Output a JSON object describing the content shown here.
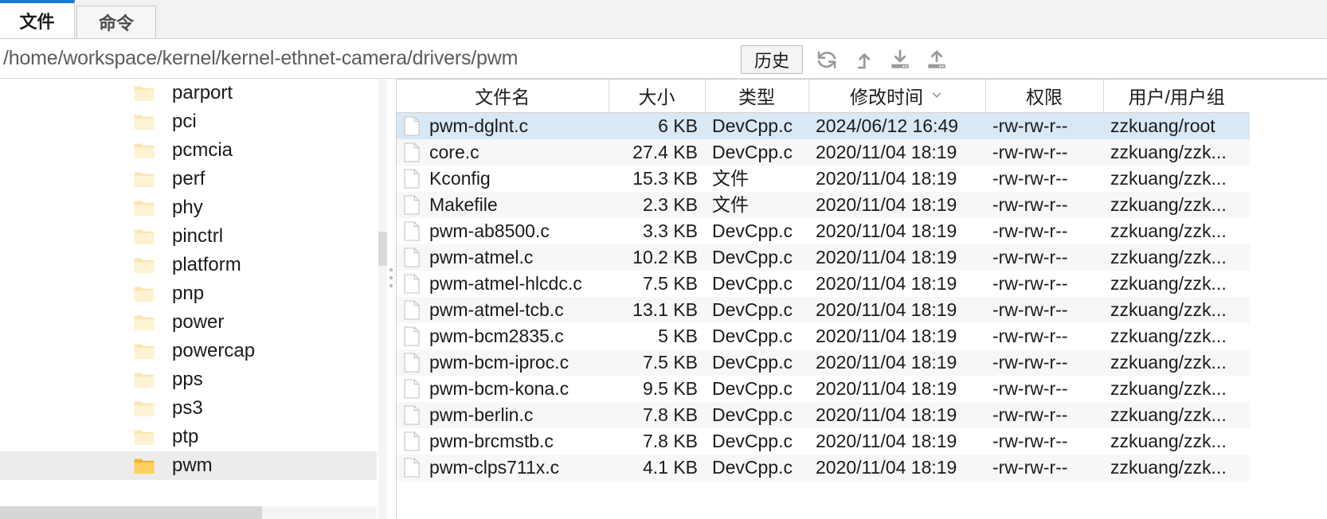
{
  "tabs": [
    {
      "label": "文件",
      "active": true,
      "name": "tab-files"
    },
    {
      "label": "命令",
      "active": false,
      "name": "tab-command"
    }
  ],
  "pathbar": {
    "path": "/home/workspace/kernel/kernel-ethnet-camera/drivers/pwm",
    "history_label": "历史",
    "icons": [
      {
        "name": "refresh-icon",
        "title": "刷新"
      },
      {
        "name": "parent-folder-up-icon",
        "title": "上级目录"
      },
      {
        "name": "download-icon",
        "title": "下载"
      },
      {
        "name": "upload-icon",
        "title": "上传"
      }
    ]
  },
  "tree": {
    "items": [
      {
        "label": "parport",
        "selected": false
      },
      {
        "label": "pci",
        "selected": false
      },
      {
        "label": "pcmcia",
        "selected": false
      },
      {
        "label": "perf",
        "selected": false
      },
      {
        "label": "phy",
        "selected": false
      },
      {
        "label": "pinctrl",
        "selected": false
      },
      {
        "label": "platform",
        "selected": false
      },
      {
        "label": "pnp",
        "selected": false
      },
      {
        "label": "power",
        "selected": false
      },
      {
        "label": "powercap",
        "selected": false
      },
      {
        "label": "pps",
        "selected": false
      },
      {
        "label": "ps3",
        "selected": false
      },
      {
        "label": "ptp",
        "selected": false
      },
      {
        "label": "pwm",
        "selected": true
      }
    ]
  },
  "filelist": {
    "columns": [
      {
        "label": "文件名",
        "name": "col-filename",
        "sorted": false
      },
      {
        "label": "大小",
        "name": "col-size",
        "sorted": false
      },
      {
        "label": "类型",
        "name": "col-type",
        "sorted": false
      },
      {
        "label": "修改时间",
        "name": "col-mtime",
        "sorted": true
      },
      {
        "label": "权限",
        "name": "col-permissions",
        "sorted": false
      },
      {
        "label": "用户/用户组",
        "name": "col-owner",
        "sorted": false
      }
    ],
    "rows": [
      {
        "name": "pwm-dglnt.c",
        "size": "6 KB",
        "type": "DevCpp.c",
        "mtime": "2024/06/12 16:49",
        "perm": "-rw-rw-r--",
        "owner": "zzkuang/root",
        "selected": true
      },
      {
        "name": "core.c",
        "size": "27.4 KB",
        "type": "DevCpp.c",
        "mtime": "2020/11/04 18:19",
        "perm": "-rw-rw-r--",
        "owner": "zzkuang/zzk...",
        "selected": false
      },
      {
        "name": "Kconfig",
        "size": "15.3 KB",
        "type": "文件",
        "mtime": "2020/11/04 18:19",
        "perm": "-rw-rw-r--",
        "owner": "zzkuang/zzk...",
        "selected": false
      },
      {
        "name": "Makefile",
        "size": "2.3 KB",
        "type": "文件",
        "mtime": "2020/11/04 18:19",
        "perm": "-rw-rw-r--",
        "owner": "zzkuang/zzk...",
        "selected": false
      },
      {
        "name": "pwm-ab8500.c",
        "size": "3.3 KB",
        "type": "DevCpp.c",
        "mtime": "2020/11/04 18:19",
        "perm": "-rw-rw-r--",
        "owner": "zzkuang/zzk...",
        "selected": false
      },
      {
        "name": "pwm-atmel.c",
        "size": "10.2 KB",
        "type": "DevCpp.c",
        "mtime": "2020/11/04 18:19",
        "perm": "-rw-rw-r--",
        "owner": "zzkuang/zzk...",
        "selected": false
      },
      {
        "name": "pwm-atmel-hlcdc.c",
        "size": "7.5 KB",
        "type": "DevCpp.c",
        "mtime": "2020/11/04 18:19",
        "perm": "-rw-rw-r--",
        "owner": "zzkuang/zzk...",
        "selected": false
      },
      {
        "name": "pwm-atmel-tcb.c",
        "size": "13.1 KB",
        "type": "DevCpp.c",
        "mtime": "2020/11/04 18:19",
        "perm": "-rw-rw-r--",
        "owner": "zzkuang/zzk...",
        "selected": false
      },
      {
        "name": "pwm-bcm2835.c",
        "size": "5 KB",
        "type": "DevCpp.c",
        "mtime": "2020/11/04 18:19",
        "perm": "-rw-rw-r--",
        "owner": "zzkuang/zzk...",
        "selected": false
      },
      {
        "name": "pwm-bcm-iproc.c",
        "size": "7.5 KB",
        "type": "DevCpp.c",
        "mtime": "2020/11/04 18:19",
        "perm": "-rw-rw-r--",
        "owner": "zzkuang/zzk...",
        "selected": false
      },
      {
        "name": "pwm-bcm-kona.c",
        "size": "9.5 KB",
        "type": "DevCpp.c",
        "mtime": "2020/11/04 18:19",
        "perm": "-rw-rw-r--",
        "owner": "zzkuang/zzk...",
        "selected": false
      },
      {
        "name": "pwm-berlin.c",
        "size": "7.8 KB",
        "type": "DevCpp.c",
        "mtime": "2020/11/04 18:19",
        "perm": "-rw-rw-r--",
        "owner": "zzkuang/zzk...",
        "selected": false
      },
      {
        "name": "pwm-brcmstb.c",
        "size": "7.8 KB",
        "type": "DevCpp.c",
        "mtime": "2020/11/04 18:19",
        "perm": "-rw-rw-r--",
        "owner": "zzkuang/zzk...",
        "selected": false
      },
      {
        "name": "pwm-clps711x.c",
        "size": "4.1 KB",
        "type": "DevCpp.c",
        "mtime": "2020/11/04 18:19",
        "perm": "-rw-rw-r--",
        "owner": "zzkuang/zzk...",
        "selected": false
      }
    ]
  },
  "colors": {
    "accent": "#1a78d9",
    "selection": "#d9e8f5",
    "tree_selection": "#ececec",
    "folder": "#fce8b2",
    "folder_selected": "#f9c councils"
  }
}
